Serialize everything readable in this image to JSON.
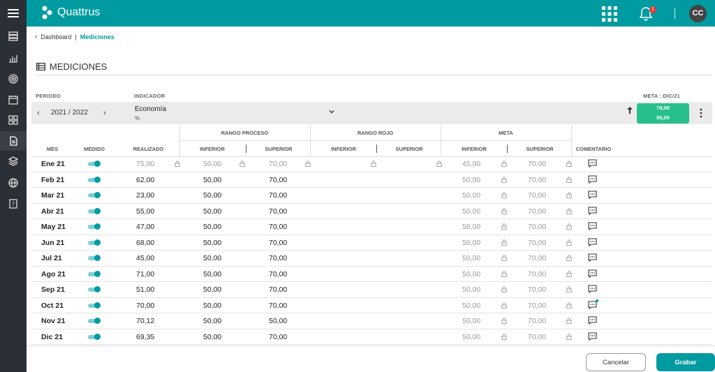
{
  "app": {
    "name": "Quattrus",
    "user_initials": "CC",
    "notifications": "1"
  },
  "breadcrumb": {
    "parent": "Dashboard",
    "current": "Mediciones"
  },
  "page_title": "MEDICIONES",
  "labels": {
    "periodo": "PERIODO",
    "indicador": "INDICADOR",
    "meta": "META : DIC/21"
  },
  "selector": {
    "period": "2021 / 2022",
    "indicator_name": "Economía",
    "indicator_unit": "%",
    "meta_upper": "70,00",
    "meta_lower": "50,00"
  },
  "table": {
    "groups": {
      "rango_proceso": "RANGO PROCESO",
      "rango_rojo": "RANGO ROJO",
      "meta": "META"
    },
    "headers": {
      "mes": "MES",
      "medido": "MEDIDO",
      "realizado": "REALIZADO",
      "inferior": "INFERIOR",
      "superior": "SUPERIOR",
      "comentario": "COMENTARIO"
    },
    "rows": [
      {
        "mes": "Ene 21",
        "realizado": "75,00",
        "rp_inf": "50,00",
        "rp_sup": "70,00",
        "meta_inf": "45,00",
        "meta_sup": "70,00"
      },
      {
        "mes": "Feb 21",
        "realizado": "62,00",
        "rp_inf": "50,00",
        "rp_sup": "70,00",
        "meta_inf": "50,00",
        "meta_sup": "70,00"
      },
      {
        "mes": "Mar 21",
        "realizado": "23,00",
        "rp_inf": "50,00",
        "rp_sup": "70,00",
        "meta_inf": "50,00",
        "meta_sup": "70,00"
      },
      {
        "mes": "Abr 21",
        "realizado": "55,00",
        "rp_inf": "50,00",
        "rp_sup": "70,00",
        "meta_inf": "50,00",
        "meta_sup": "70,00"
      },
      {
        "mes": "May 21",
        "realizado": "47,00",
        "rp_inf": "50,00",
        "rp_sup": "70,00",
        "meta_inf": "50,00",
        "meta_sup": "70,00"
      },
      {
        "mes": "Jun 21",
        "realizado": "68,00",
        "rp_inf": "50,00",
        "rp_sup": "70,00",
        "meta_inf": "50,00",
        "meta_sup": "70,00"
      },
      {
        "mes": "Jul 21",
        "realizado": "45,00",
        "rp_inf": "50,00",
        "rp_sup": "70,00",
        "meta_inf": "50,00",
        "meta_sup": "70,00"
      },
      {
        "mes": "Ago 21",
        "realizado": "71,00",
        "rp_inf": "50,00",
        "rp_sup": "70,00",
        "meta_inf": "50,00",
        "meta_sup": "70,00"
      },
      {
        "mes": "Sep 21",
        "realizado": "51,00",
        "rp_inf": "50,00",
        "rp_sup": "70,00",
        "meta_inf": "50,00",
        "meta_sup": "70,00"
      },
      {
        "mes": "Oct 21",
        "realizado": "70,00",
        "rp_inf": "50,00",
        "rp_sup": "70,00",
        "meta_inf": "50,00",
        "meta_sup": "70,00"
      },
      {
        "mes": "Nov 21",
        "realizado": "70,12",
        "rp_inf": "50,00",
        "rp_sup": "50,00",
        "meta_inf": "50,00",
        "meta_sup": "70,00"
      },
      {
        "mes": "Dic 21",
        "realizado": "69,35",
        "rp_inf": "50,00",
        "rp_sup": "70,00",
        "meta_inf": "50,00",
        "meta_sup": "70,00"
      }
    ]
  },
  "buttons": {
    "cancel": "Cancelar",
    "save": "Grabar"
  },
  "colors": {
    "primary": "#009ba0",
    "rail": "#2b2f36",
    "meta_box": "#27c08a"
  }
}
